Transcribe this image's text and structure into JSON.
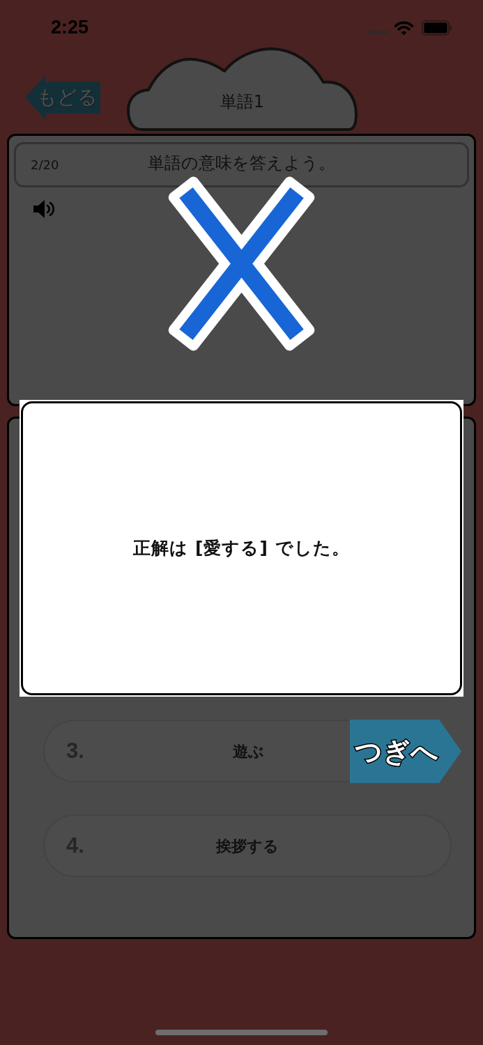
{
  "status_bar": {
    "time": "2:25"
  },
  "header": {
    "back_button": "もどる",
    "title": "単語1"
  },
  "question_card": {
    "progress": "2/20",
    "instruction": "単語の意味を答えよう。"
  },
  "answer_result": {
    "correct": false
  },
  "options": [
    {
      "number": "3.",
      "label": "遊ぶ"
    },
    {
      "number": "4.",
      "label": "挨拶する"
    }
  ],
  "result_dialog": {
    "message": "正解は [愛する] でした。"
  },
  "next_button": {
    "label": "つぎへ"
  }
}
